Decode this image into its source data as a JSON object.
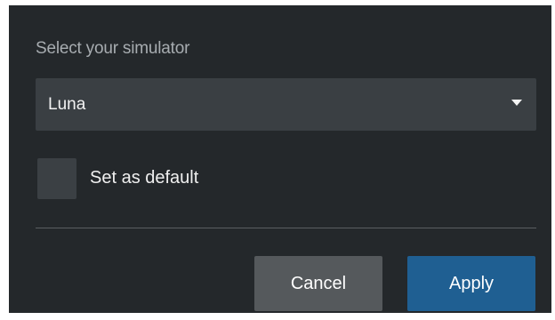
{
  "dialog": {
    "prompt": "Select your simulator",
    "simulator_select": {
      "value": "Luna"
    },
    "default_checkbox": {
      "label": "Set as default",
      "checked": false
    },
    "buttons": {
      "cancel": "Cancel",
      "apply": "Apply"
    }
  },
  "icons": {
    "dropdown": "caret-down-icon"
  },
  "colors": {
    "background": "#24282b",
    "control": "#3a3f43",
    "cancel_button": "#55595c",
    "apply_button": "#1f5f92",
    "prompt_text": "#a7acb0"
  }
}
